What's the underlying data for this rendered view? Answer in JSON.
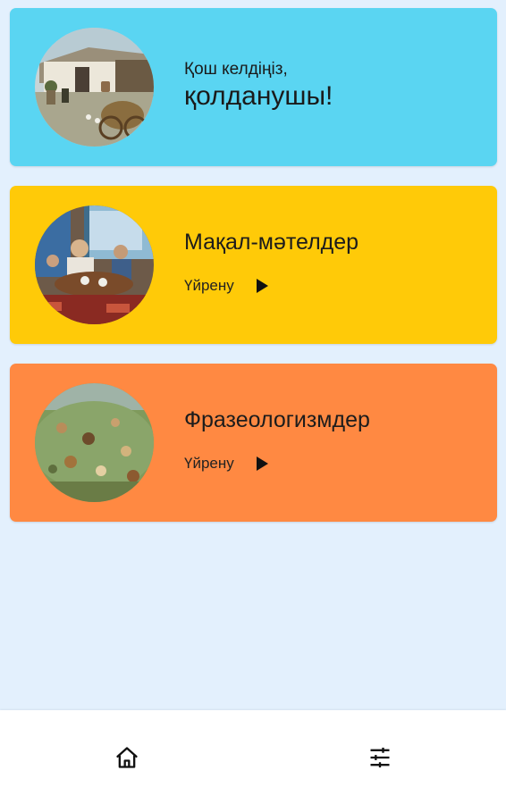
{
  "welcome": {
    "line1": "Қош келдіңіз,",
    "line2": "қолданушы!"
  },
  "cards": [
    {
      "title": "Мақал-мәтелдер",
      "action_label": "Үйрену"
    },
    {
      "title": "Фразеологизмдер",
      "action_label": "Үйрену"
    }
  ],
  "colors": {
    "background": "#e3f0fd",
    "welcome_card": "#5ad5f2",
    "proverbs_card": "#ffca08",
    "phrases_card": "#ff8942"
  },
  "bottom_nav": {
    "items": [
      {
        "icon": "home-icon"
      },
      {
        "icon": "sliders-icon"
      }
    ]
  }
}
